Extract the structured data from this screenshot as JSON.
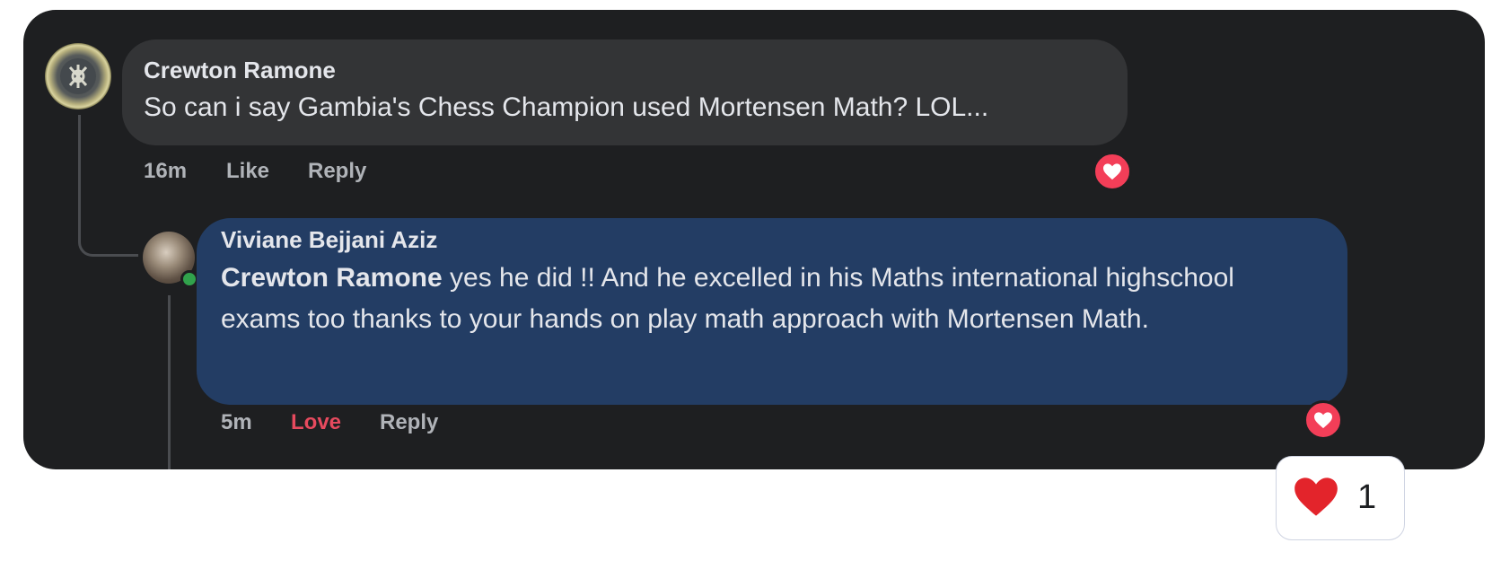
{
  "comment": {
    "author": "Crewton Ramone",
    "text": "So can i say Gambia's Chess Champion used Mortensen Math? LOL...",
    "time": "16m",
    "like_label": "Like",
    "reply_label": "Reply",
    "avatar_icon": "logo-avatar"
  },
  "reply": {
    "author": "Viviane Bejjani Aziz",
    "mention": "Crewton Ramone",
    "text": " yes he did !! And he excelled in his Maths international highschool exams too thanks to your hands on play math approach with Mortensen Math.",
    "time": "5m",
    "love_label": "Love",
    "reply_label": "Reply",
    "online": true
  },
  "reaction_summary": {
    "icon": "red-heart-icon",
    "count": "1"
  },
  "colors": {
    "card_bg": "#1e1f21",
    "comment_bubble": "#333436",
    "reply_bubble": "#233d64",
    "love_accent": "#e64a5e",
    "heart_badge": "#f33e58",
    "online_green": "#31a24c"
  }
}
